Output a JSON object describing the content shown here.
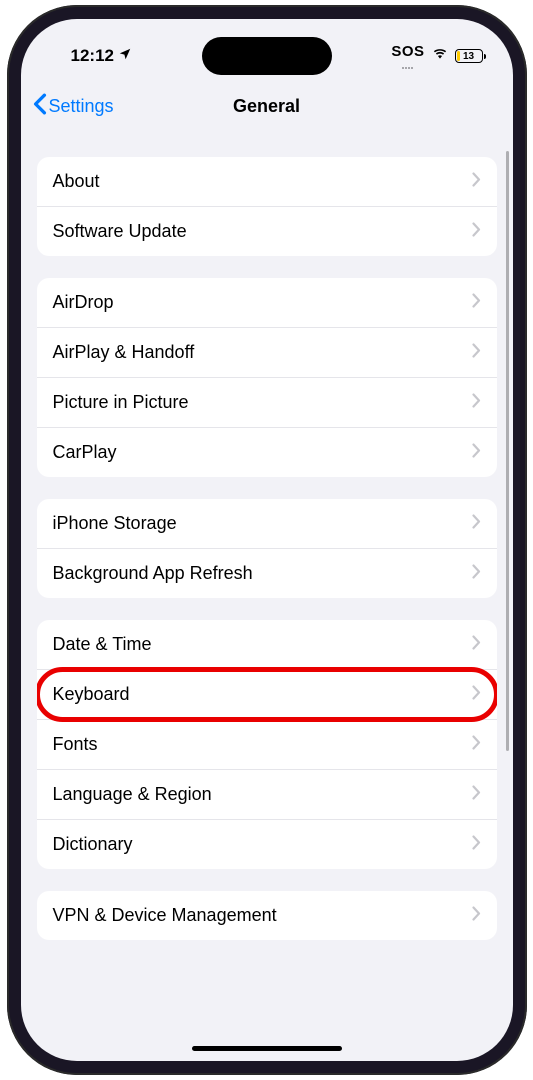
{
  "statusBar": {
    "time": "12:12",
    "sos": "SOS",
    "battery": "13"
  },
  "nav": {
    "back": "Settings",
    "title": "General"
  },
  "sections": [
    {
      "rows": [
        {
          "label": "About",
          "name": "row-about"
        },
        {
          "label": "Software Update",
          "name": "row-software-update"
        }
      ]
    },
    {
      "rows": [
        {
          "label": "AirDrop",
          "name": "row-airdrop"
        },
        {
          "label": "AirPlay & Handoff",
          "name": "row-airplay-handoff"
        },
        {
          "label": "Picture in Picture",
          "name": "row-picture-in-picture"
        },
        {
          "label": "CarPlay",
          "name": "row-carplay"
        }
      ]
    },
    {
      "rows": [
        {
          "label": "iPhone Storage",
          "name": "row-iphone-storage"
        },
        {
          "label": "Background App Refresh",
          "name": "row-background-app-refresh"
        }
      ]
    },
    {
      "rows": [
        {
          "label": "Date & Time",
          "name": "row-date-time"
        },
        {
          "label": "Keyboard",
          "name": "row-keyboard",
          "highlighted": true
        },
        {
          "label": "Fonts",
          "name": "row-fonts"
        },
        {
          "label": "Language & Region",
          "name": "row-language-region"
        },
        {
          "label": "Dictionary",
          "name": "row-dictionary"
        }
      ]
    },
    {
      "rows": [
        {
          "label": "VPN & Device Management",
          "name": "row-vpn-device-management"
        }
      ]
    }
  ]
}
